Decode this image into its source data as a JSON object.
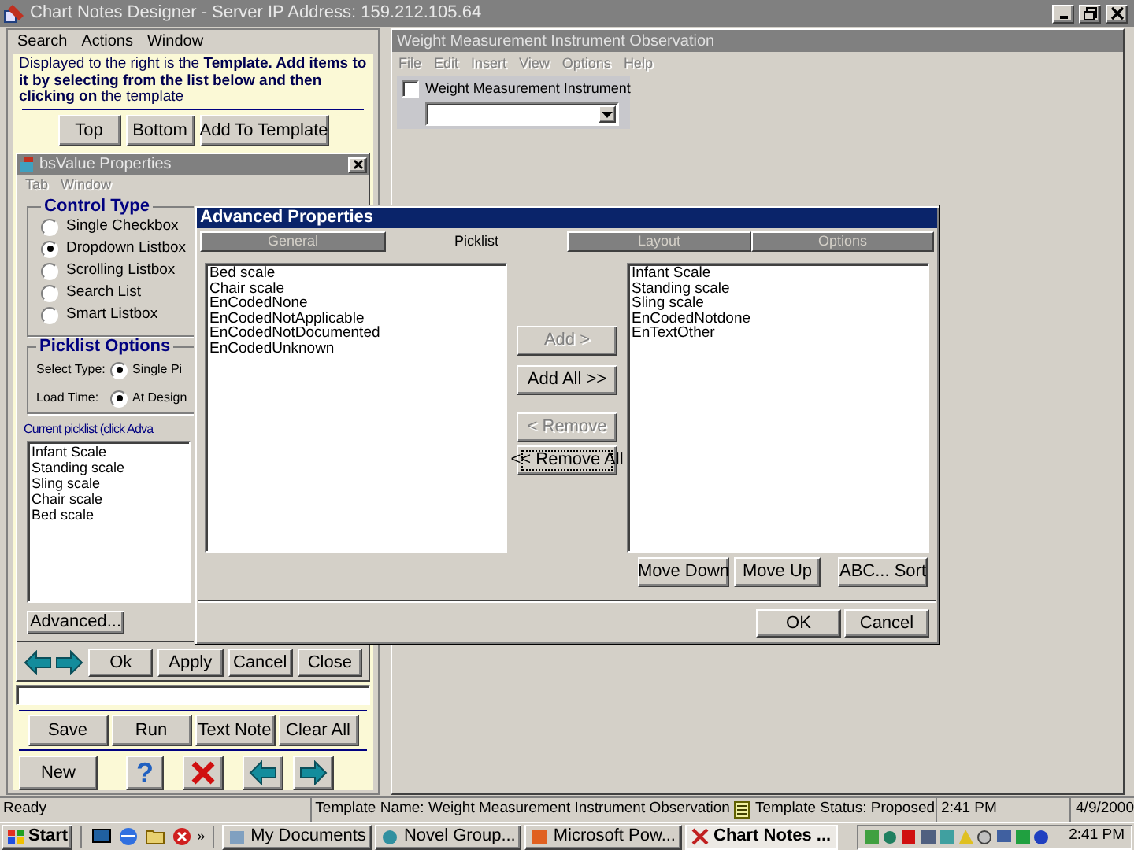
{
  "app": {
    "title": "Chart Notes Designer - Server IP Address: 159.212.105.64"
  },
  "menu": [
    "Search",
    "Actions",
    "Window"
  ],
  "instructions": "Displayed to the right is the **Template.  Add items to it by selecting from the list below and then clicking on** the template",
  "template_buttons": [
    "Top",
    "Bottom",
    "Add To Template"
  ],
  "properties_window": {
    "title": "bsValue Properties",
    "menu": [
      "Tab",
      "Window"
    ],
    "control_type": {
      "label": "Control Type",
      "options": [
        {
          "label": "Single Checkbox",
          "selected": false
        },
        {
          "label": "Dropdown Listbox",
          "selected": true
        },
        {
          "label": "Scrolling Listbox",
          "selected": false
        },
        {
          "label": "Search List",
          "selected": false
        },
        {
          "label": "Smart Listbox",
          "selected": false
        }
      ]
    },
    "picklist_options": {
      "label": "Picklist Options",
      "rows": [
        {
          "label": "Select Type:",
          "option": "Single Pi",
          "selected": true
        },
        {
          "label": "Load Time:",
          "option": "At Design",
          "selected": true
        }
      ]
    },
    "current_picklist_label": "Current picklist (click Adva",
    "current_picklist": [
      "Infant Scale",
      "Standing scale",
      "Sling scale",
      "Chair scale",
      "Bed scale"
    ],
    "advanced_button": "Advanced...",
    "buttons": [
      "Ok",
      "Apply",
      "Cancel",
      "Close"
    ]
  },
  "bottom_buttons": [
    "Save",
    "Run",
    "Text Note",
    "Clear All"
  ],
  "new_button": "New",
  "help_button": "?",
  "template_window": {
    "title": "Weight Measurement Instrument Observation",
    "menu": [
      "File",
      "Edit",
      "Insert",
      "View",
      "Options",
      "Help"
    ],
    "field": {
      "label": "Weight Measurement Instrument",
      "checked": false
    }
  },
  "dialog": {
    "title": "Advanced Properties",
    "tabs": [
      {
        "label": "General",
        "selected": false
      },
      {
        "label": "Picklist",
        "selected": true
      },
      {
        "label": "Layout",
        "selected": false
      },
      {
        "label": "Options",
        "selected": false
      }
    ],
    "available": [
      "Bed scale",
      "Chair scale",
      "EnCodedNone",
      "EnCodedNotApplicable",
      "EnCodedNotDocumented",
      "EnCodedUnknown"
    ],
    "move_buttons": [
      {
        "label": "Add >",
        "disabled": true
      },
      {
        "label": "Add All >>",
        "disabled": false
      },
      {
        "label": "< Remove",
        "disabled": true
      },
      {
        "label": "<< Remove All",
        "disabled": false
      }
    ],
    "chosen": [
      "Infant Scale",
      "Standing scale",
      "Sling scale",
      "EnCodedNotdone",
      "EnTextOther"
    ],
    "order_buttons": [
      "Move Down",
      "Move Up",
      "ABC... Sort"
    ],
    "footer_buttons": [
      "OK",
      "Cancel"
    ]
  },
  "status_bar": {
    "state": "Ready",
    "template_name": "Template Name: Weight Measurement Instrument Observation",
    "template_status": "Template Status: Proposed",
    "time": "2:41 PM",
    "date": "4/9/2000"
  },
  "taskbar": {
    "start": "Start",
    "more": "»",
    "tasks": [
      {
        "label": "My Documents",
        "selected": false
      },
      {
        "label": "Novel Group...",
        "selected": false
      },
      {
        "label": "Microsoft Pow...",
        "selected": false
      },
      {
        "label": "Chart Notes ...",
        "selected": true
      }
    ],
    "clock": "2:41 PM"
  }
}
